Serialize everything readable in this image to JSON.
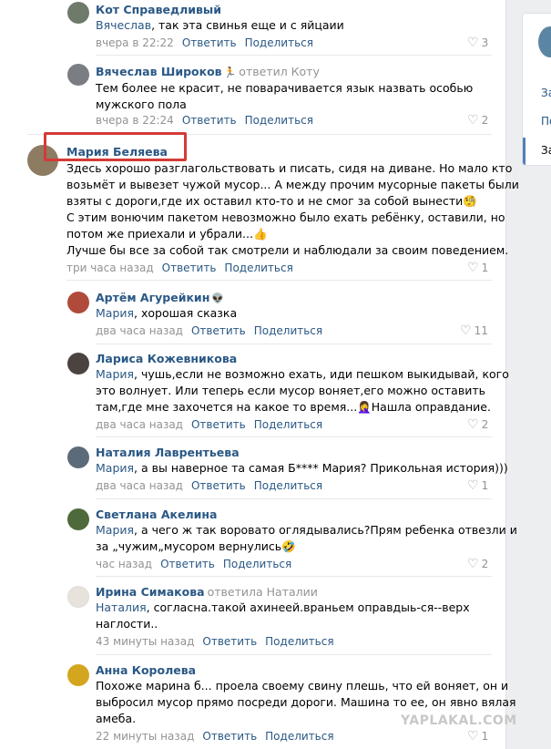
{
  "comments": [
    {
      "author": "Кот Справедливый",
      "lines": [
        {
          "addressee": "Вячеслав",
          "rest": ", так эта свинья еще и с яйцаии"
        }
      ],
      "time": "вчера в 22:22",
      "reply_label": "Ответить",
      "share_label": "Поделиться",
      "likes": "3"
    },
    {
      "author": "Вячеслав Широков",
      "author_emoji": "🏃",
      "reply_to": "ответил Коту",
      "lines": [
        {
          "rest": "Тем более не красит, не поварачивается язык назвать особью"
        },
        {
          "rest": "мужского пола"
        }
      ],
      "time": "вчера в 22:24",
      "reply_label": "Ответить",
      "share_label": "Поделиться",
      "likes": "2"
    },
    {
      "author": "Мария Беляева",
      "lines": [
        {
          "rest": "Здесь хорошо разглагольствовать и писать, сидя на диване. Но мало кто"
        },
        {
          "rest": "возьмёт и вывезет чужой мусор... А между прочим мусорные пакеты были"
        },
        {
          "rest": "взяты с дороги,где их оставил кто-то и не смог за собой вынести🧐"
        },
        {
          "rest": "С этим вонючим пакетом невозможно было ехать ребёнку, оставили, но"
        },
        {
          "rest": "потом же приехали и убрали...👍"
        },
        {
          "rest": "Лучше бы все за собой так смотрели и наблюдали за своим поведением."
        }
      ],
      "time": "три часа назад",
      "reply_label": "Ответить",
      "share_label": "Поделиться",
      "likes": "1"
    },
    {
      "author": "Артём Агурейкин",
      "author_emoji": "👽",
      "lines": [
        {
          "addressee": "Мария",
          "rest": ", хорошая сказка"
        }
      ],
      "time": "два часа назад",
      "reply_label": "Ответить",
      "share_label": "Поделиться",
      "likes": "11"
    },
    {
      "author": "Лариса Кожевникова",
      "lines": [
        {
          "addressee": "Мария",
          "rest": ", чушь,если не возможно ехать, иди пешком выкидывай, кого"
        },
        {
          "rest": "это волнует. Или теперь если мусор воняет,его можно оставить"
        },
        {
          "rest": "там,где мне захочется на какое то время...🤦‍♀️Нашла оправдание."
        }
      ],
      "time": "два часа назад",
      "reply_label": "Ответить",
      "share_label": "Поделиться",
      "likes": "2"
    },
    {
      "author": "Наталия Лаврентьева",
      "lines": [
        {
          "addressee": "Мария",
          "rest": ", а вы наверное та самая Б**** Мария? Прикольная история)))"
        }
      ],
      "time": "два часа назад",
      "reply_label": "Ответить",
      "share_label": "Поделиться",
      "likes": "1"
    },
    {
      "author": "Светлана Акелина",
      "lines": [
        {
          "addressee": "Мария",
          "rest": ", а чего ж так воровато оглядывались?Прям ребенка отвезли и"
        },
        {
          "rest": "за „чужим„мусором вернулись🤣"
        }
      ],
      "time": "час назад",
      "reply_label": "Ответить",
      "share_label": "Поделиться",
      "likes": "2"
    },
    {
      "author": "Ирина Симакова",
      "reply_to": "ответила Наталии",
      "lines": [
        {
          "addressee": "Наталия",
          "rest": ", согласна.такой ахинеей.враньем оправдыь-ся--верх"
        },
        {
          "rest": "наглости.."
        }
      ],
      "time": "43 минуты назад",
      "reply_label": "Ответить",
      "share_label": "Поделиться",
      "likes": ""
    },
    {
      "author": "Анна Королева",
      "lines": [
        {
          "rest": "Похоже марина б... проела своему свину плешь, что ей воняет, он и"
        },
        {
          "rest": "выбросил мусор прямо посреди дороги. Машина то ее, он явно вялая"
        },
        {
          "rest": "амеба."
        }
      ],
      "time": "22 минуты назад",
      "reply_label": "Ответить",
      "share_label": "Поделиться",
      "likes": "1"
    }
  ],
  "sidebar": {
    "items": [
      "За",
      "По",
      "За"
    ]
  },
  "watermark": "YAPLAKAL.COM",
  "colors": {
    "link": "#2a5885",
    "meta": "#939393",
    "highlight": "#d43a37",
    "background": "#edeef0"
  }
}
